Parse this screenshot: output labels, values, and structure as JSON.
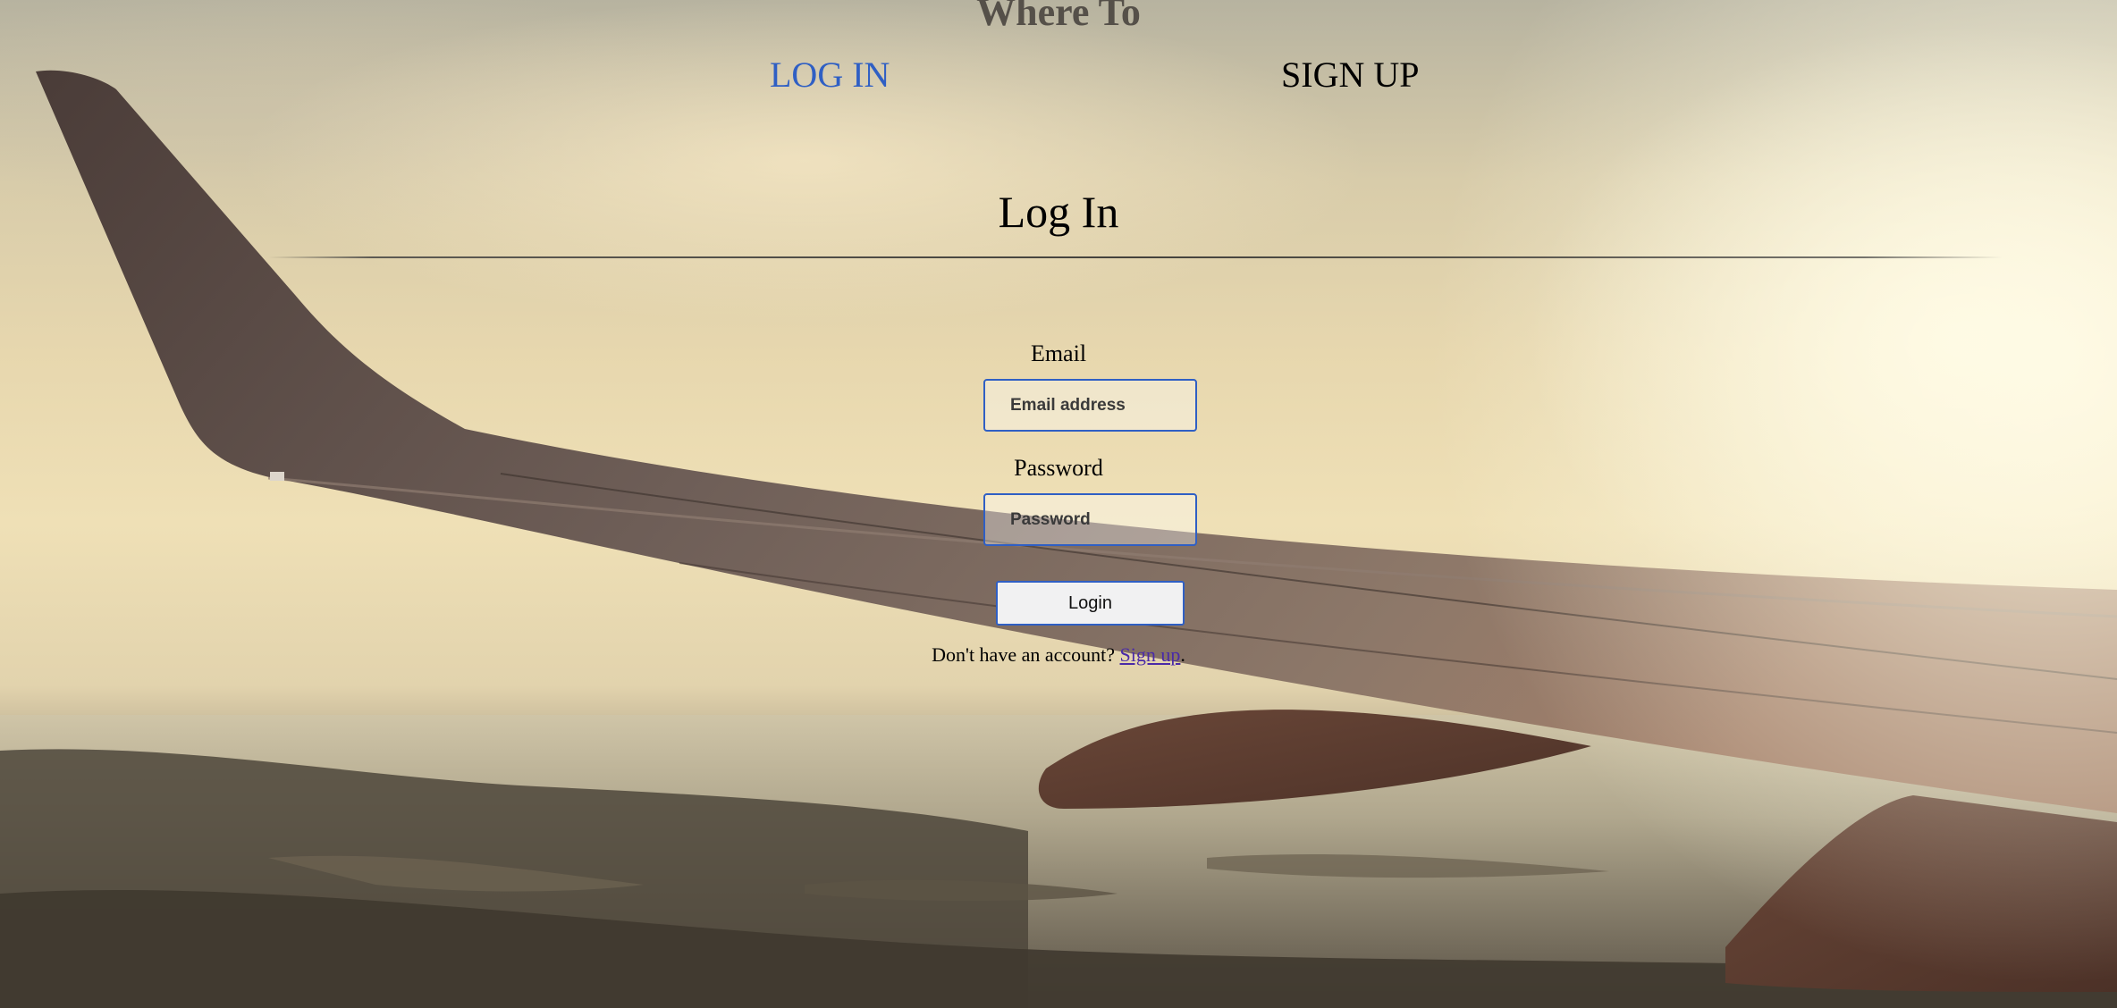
{
  "header": {
    "brand": "Where To",
    "tabs": [
      {
        "label": "LOG IN",
        "active": true,
        "color": "#2f5fc4"
      },
      {
        "label": "SIGN UP",
        "active": false,
        "color": "#000000"
      }
    ]
  },
  "main": {
    "title": "Log In",
    "email": {
      "label": "Email",
      "placeholder": "Email address",
      "value": ""
    },
    "password": {
      "label": "Password",
      "placeholder": "Password",
      "value": ""
    },
    "login_button": "Login",
    "signup_prompt": "Don't have an account?",
    "signup_link": "Sign up",
    "signup_suffix": "."
  },
  "theme": {
    "accent": "#2f5fc4",
    "link_visited": "#4a2aa8"
  }
}
